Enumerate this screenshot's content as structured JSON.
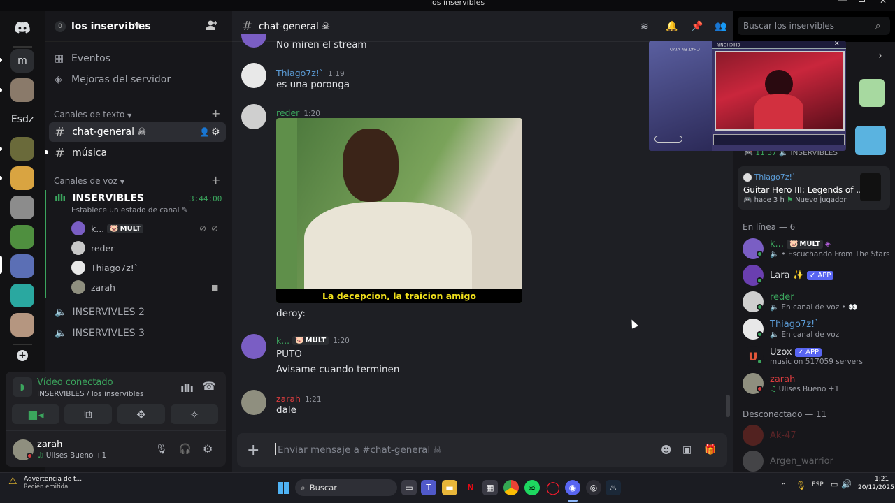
{
  "window": {
    "title": "los inservibles"
  },
  "rail": {
    "items": [
      {
        "label": "m"
      },
      {
        "label": "Esdz"
      }
    ]
  },
  "server": {
    "name": "los inservibles",
    "boosts": "0"
  },
  "sidebar": {
    "events": "Eventos",
    "boosts": "Mejoras del servidor",
    "text_category": "Canales de texto",
    "text_channels": [
      {
        "name": "chat-general ☠"
      },
      {
        "name": "música"
      }
    ],
    "voice_category": "Canales de voz",
    "voice_channels": [
      {
        "name": "INSERVIBLES",
        "timer": "3:44:00",
        "status": "Establece un estado de canal"
      },
      {
        "name": "INSERVIVLES 2"
      },
      {
        "name": "INSERVIVLES 3"
      }
    ],
    "voice_users": [
      {
        "name": "k...",
        "badge": "MULT"
      },
      {
        "name": "reder"
      },
      {
        "name": "Thiago7z!`"
      },
      {
        "name": "zarah"
      }
    ]
  },
  "voice_panel": {
    "status": "Vídeo conectado",
    "location": "INSERVIBLES / los inservibles"
  },
  "user_panel": {
    "name": "zarah",
    "activity": "Ulises Bueno +1"
  },
  "channel": {
    "name": "chat-general ☠",
    "search_placeholder": "Buscar los inservibles"
  },
  "messages": [
    {
      "text": "No miren el stream"
    },
    {
      "author": "Thiago7z!`",
      "time": "1:19",
      "text": "es una poronga",
      "color": "#5b9bd5"
    },
    {
      "author": "reder",
      "time": "1:20",
      "caption": "La decepcion, la traicion amigo",
      "text": "deroy:",
      "color": "#3ba55d"
    },
    {
      "author": "k...",
      "badge": "MULT",
      "time": "1:20",
      "text": "PUTO",
      "text2": "Avisame cuando terminen",
      "color": "#3ba55d"
    },
    {
      "author": "zarah",
      "time": "1:21",
      "text": "dale",
      "color": "#d83c3e"
    }
  ],
  "composer": {
    "placeholder": "Enviar mensaje a #chat-general ☠"
  },
  "stream": {
    "left_text": "CHAT EN VIVO",
    "top_text": "CHICHONR"
  },
  "activity_cards": [
    {
      "time": "11:37",
      "label": "INSERVIBLES"
    },
    {
      "user": "Thiago7z!`",
      "game": "Guitar Hero III: Legends of ...",
      "ago": "hace 3 h",
      "tag": "Nuevo jugador"
    }
  ],
  "members": {
    "online_header": "En línea — 6",
    "online": [
      {
        "name": "k...",
        "badge": "MULT",
        "sub": "• Escuchando From The Stars",
        "color": "#3ba55d"
      },
      {
        "name": "Lara ✨",
        "badge": "APP",
        "color": "#dbdee1"
      },
      {
        "name": "reder",
        "sub": "En canal de voz • 👀",
        "color": "#3ba55d"
      },
      {
        "name": "Thiago7z!`",
        "sub": "En canal de voz",
        "color": "#5b9bd5"
      },
      {
        "name": "Uzox",
        "badge": "APP",
        "sub": "music on 517059 servers",
        "color": "#dbdee1"
      },
      {
        "name": "zarah",
        "sub": "Ulises Bueno +1",
        "color": "#d83c3e"
      }
    ],
    "offline_header": "Desconectado — 11",
    "offline": [
      {
        "name": "Ak-47"
      },
      {
        "name": "Argen_warrior"
      }
    ]
  },
  "taskbar": {
    "notification_title": "Advertencia de t...",
    "notification_sub": "Recién emitida",
    "search": "Buscar",
    "lang": "ESP",
    "time": "1:21",
    "date": "20/12/2025"
  }
}
